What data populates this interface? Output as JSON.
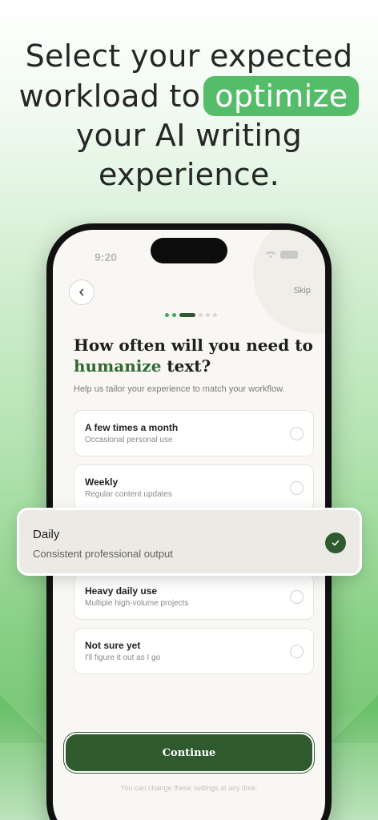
{
  "headline": {
    "line1": "Select your expected",
    "line2_pre": "workload to",
    "line2_highlight": "optimize",
    "line3": "your AI writing",
    "line4": "experience."
  },
  "status_bar": {
    "time": "9:20"
  },
  "nav": {
    "skip_label": "Skip"
  },
  "progress": {
    "step": 3,
    "total": 6
  },
  "question": {
    "pre": "How often will you need to",
    "highlight": "humanize",
    "post": " text?"
  },
  "subtitle": "Help us tailor your experience to match your workflow.",
  "options": [
    {
      "title": "A few times a month",
      "desc": "Occasional personal use",
      "selected": false
    },
    {
      "title": "Weekly",
      "desc": "Regular content updates",
      "selected": false
    },
    {
      "title": "Daily",
      "desc": "Consistent professional output",
      "selected": true
    },
    {
      "title": "Heavy daily use",
      "desc": "Multiple high-volume projects",
      "selected": false
    },
    {
      "title": "Not sure yet",
      "desc": "I'll figure it out as I go",
      "selected": false
    }
  ],
  "continue_label": "Continue",
  "footnote": "You can change these settings at any time.",
  "colors": {
    "accent": "#2f5a2e",
    "highlight_pill": "#55bd6a",
    "progress_done": "#3ca95c"
  }
}
